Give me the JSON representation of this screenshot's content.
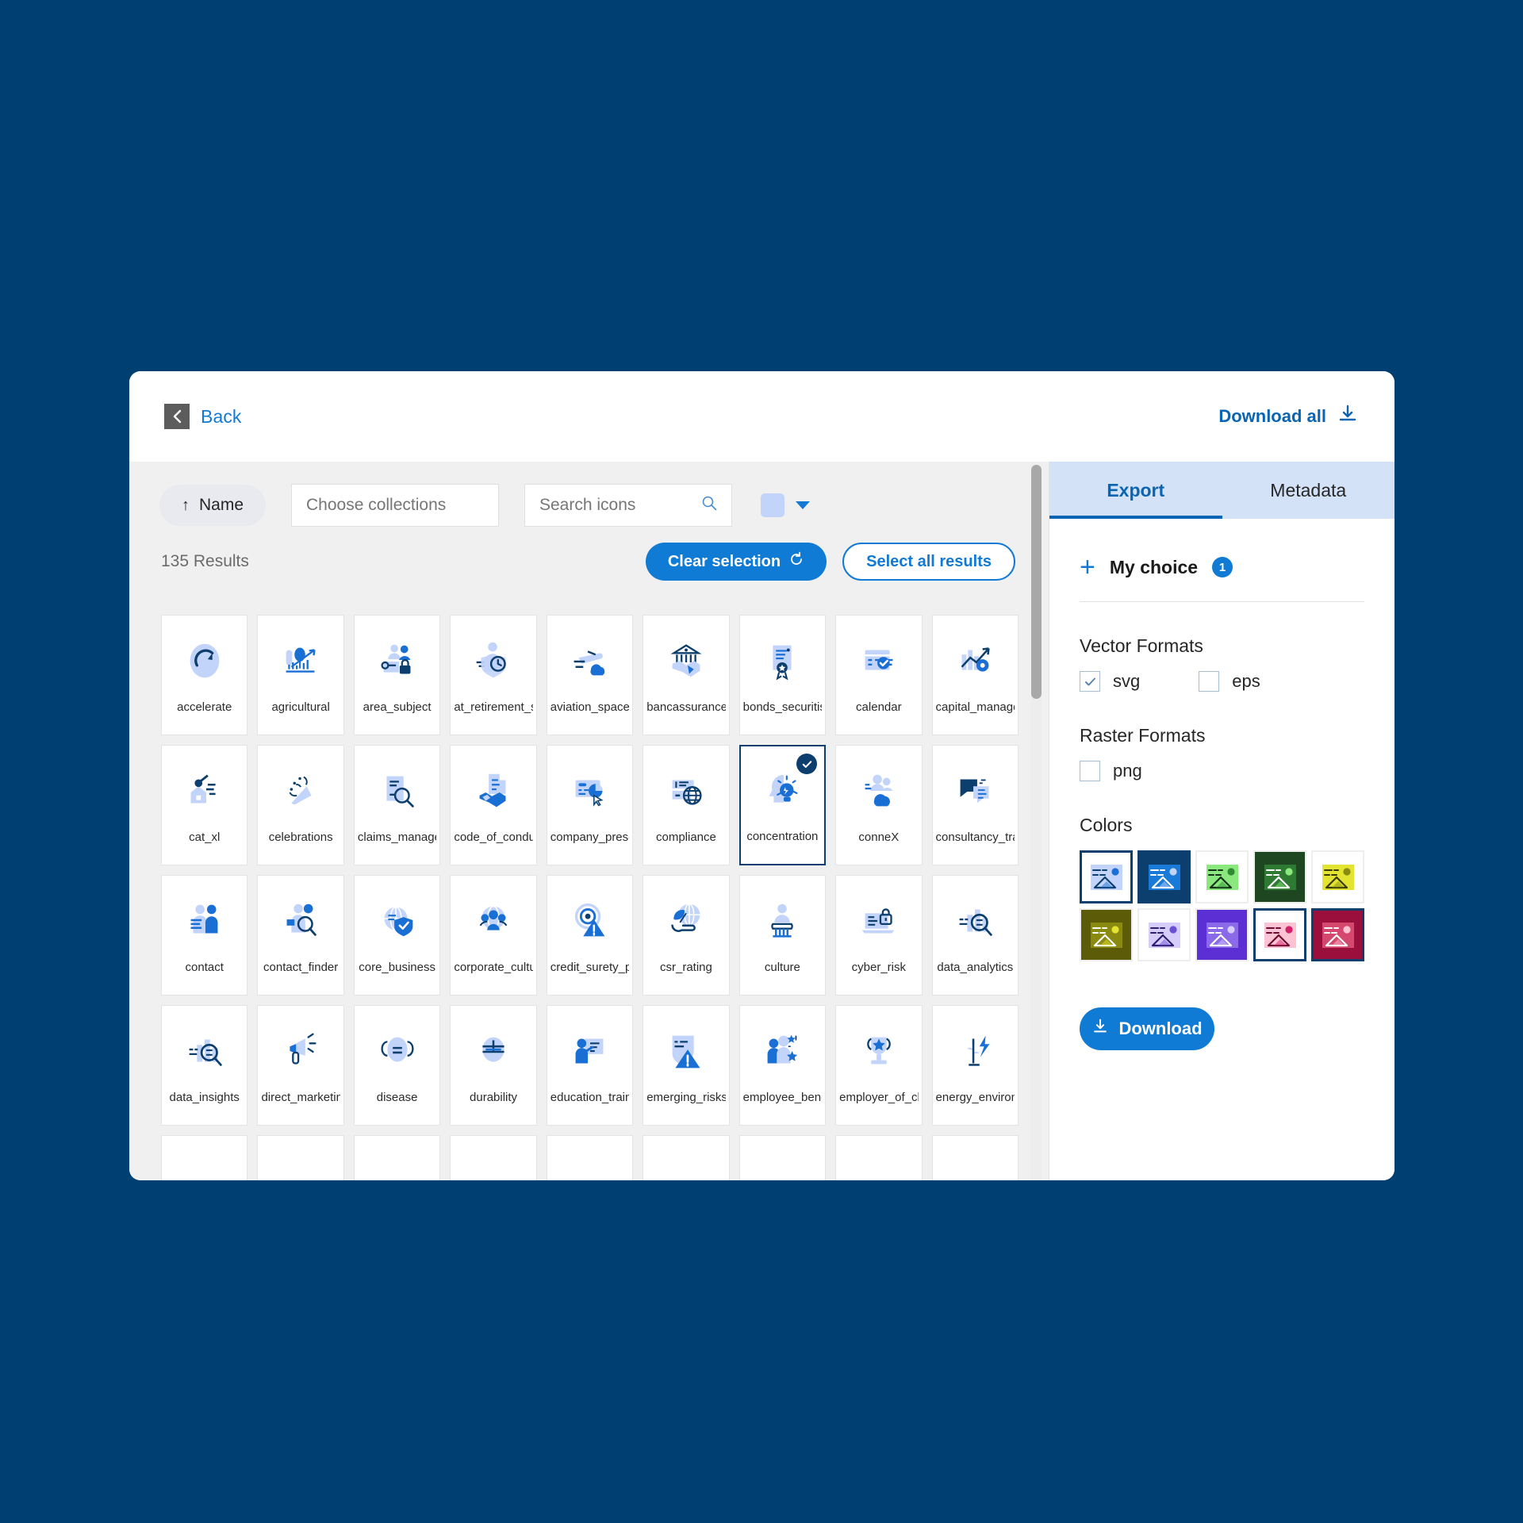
{
  "header": {
    "back_label": "Back",
    "download_all_label": "Download all"
  },
  "toolbar": {
    "sort_label": "Name",
    "sort_direction_icon": "arrow-up-icon",
    "collections_placeholder": "Choose collections",
    "collections_value": "",
    "search_placeholder": "Search icons",
    "search_value": "",
    "color_swatch_hex": "#c3d4fb"
  },
  "results": {
    "count_label": "135 Results",
    "clear_selection_label": "Clear selection",
    "select_all_label": "Select all results"
  },
  "grid": {
    "items": [
      {
        "label": "accelerate",
        "icon": "speedometer-icon",
        "selected": false
      },
      {
        "label": "agricultural",
        "icon": "agriculture-chart-icon",
        "selected": false
      },
      {
        "label": "area_subject",
        "icon": "people-lock-icon",
        "selected": false
      },
      {
        "label": "at_retirement_sol...",
        "icon": "person-shield-clock-icon",
        "selected": false
      },
      {
        "label": "aviation_space",
        "icon": "plane-cloud-icon",
        "selected": false
      },
      {
        "label": "bancassurance",
        "icon": "bank-handshake-icon",
        "selected": false
      },
      {
        "label": "bonds_securitisa...",
        "icon": "certificate-icon",
        "selected": false
      },
      {
        "label": "calendar",
        "icon": "calendar-check-icon",
        "selected": false
      },
      {
        "label": "capital_manage...",
        "icon": "bars-gear-arrow-icon",
        "selected": false
      },
      {
        "label": "cat_xl",
        "icon": "house-storm-icon",
        "selected": false
      },
      {
        "label": "celebrations",
        "icon": "party-popper-icon",
        "selected": false
      },
      {
        "label": "claims_manage...",
        "icon": "document-magnifier-icon",
        "selected": false
      },
      {
        "label": "code_of_conduct",
        "icon": "document-handshake-icon",
        "selected": false
      },
      {
        "label": "company_presen...",
        "icon": "presentation-cursor-icon",
        "selected": false
      },
      {
        "label": "compliance",
        "icon": "paragraph-globe-icon",
        "selected": false
      },
      {
        "label": "concentration",
        "icon": "head-lightbulb-icon",
        "selected": true
      },
      {
        "label": "conneX",
        "icon": "people-cloud-icon",
        "selected": false
      },
      {
        "label": "consultancy_trai...",
        "icon": "chat-bubbles-icon",
        "selected": false
      },
      {
        "label": "contact",
        "icon": "person-card-icon",
        "selected": false
      },
      {
        "label": "contact_finder",
        "icon": "person-search-icon",
        "selected": false
      },
      {
        "label": "core_business",
        "icon": "globe-shield-icon",
        "selected": false
      },
      {
        "label": "corporate_culture",
        "icon": "people-globe-icon",
        "selected": false
      },
      {
        "label": "credit_surety_pol...",
        "icon": "target-warning-icon",
        "selected": false
      },
      {
        "label": "csr_rating",
        "icon": "hand-leaf-globe-icon",
        "selected": false
      },
      {
        "label": "culture",
        "icon": "museum-bust-icon",
        "selected": false
      },
      {
        "label": "cyber_risk",
        "icon": "laptop-lock-icon",
        "selected": false
      },
      {
        "label": "data_analytics",
        "icon": "bars-magnifier-icon",
        "selected": false
      },
      {
        "label": "data_insights",
        "icon": "bars-magnifier-icon",
        "selected": false
      },
      {
        "label": "direct_marketing",
        "icon": "megaphone-icon",
        "selected": false
      },
      {
        "label": "disease",
        "icon": "face-mask-icon",
        "selected": false
      },
      {
        "label": "durability",
        "icon": "durability-gauge-icon",
        "selected": false
      },
      {
        "label": "education_training",
        "icon": "teacher-board-icon",
        "selected": false
      },
      {
        "label": "emerging_risks",
        "icon": "shield-warning-icon",
        "selected": false
      },
      {
        "label": "employee_benefits",
        "icon": "people-stars-icon",
        "selected": false
      },
      {
        "label": "employer_of_cho...",
        "icon": "trophy-star-icon",
        "selected": false
      },
      {
        "label": "energy_environm...",
        "icon": "plant-bolt-icon",
        "selected": false
      }
    ]
  },
  "panel": {
    "tabs": [
      {
        "label": "Export",
        "active": true
      },
      {
        "label": "Metadata",
        "active": false
      }
    ],
    "my_choice_label": "My choice",
    "my_choice_count": "1",
    "vector_formats_title": "Vector Formats",
    "vector_formats": [
      {
        "label": "svg",
        "checked": true
      },
      {
        "label": "eps",
        "checked": false
      }
    ],
    "raster_formats_title": "Raster Formats",
    "raster_formats": [
      {
        "label": "png",
        "checked": false
      }
    ],
    "colors_title": "Colors",
    "colors": [
      {
        "bg": "#ffffff",
        "fill": "#c3d4fb",
        "accent": "#1a6fd4",
        "dark": "#0d3f6e",
        "selected": true
      },
      {
        "bg": "#0d3f6e",
        "fill": "#1a7ad8",
        "accent": "#c3d4fb",
        "dark": "#ffffff",
        "selected": true
      },
      {
        "bg": "#ffffff",
        "fill": "#8ae87f",
        "accent": "#2e8b32",
        "dark": "#16331a",
        "selected": false
      },
      {
        "bg": "#1e4620",
        "fill": "#2f7a33",
        "accent": "#8ae87f",
        "dark": "#ffffff",
        "selected": false
      },
      {
        "bg": "#ffffff",
        "fill": "#e3e331",
        "accent": "#8a8a10",
        "dark": "#3a3a08",
        "selected": false
      },
      {
        "bg": "#5c5c08",
        "fill": "#8a8a10",
        "accent": "#e3e331",
        "dark": "#ffffff",
        "selected": false
      },
      {
        "bg": "#ffffff",
        "fill": "#d6cdfb",
        "accent": "#6a4fd4",
        "dark": "#2f1f6e",
        "selected": false
      },
      {
        "bg": "#5b2fd4",
        "fill": "#8a6ae8",
        "accent": "#d6cdfb",
        "dark": "#ffffff",
        "selected": false
      },
      {
        "bg": "#ffffff",
        "fill": "#fbc3d4",
        "accent": "#d4206a",
        "dark": "#6e0d2f",
        "selected": true
      },
      {
        "bg": "#9b0f3c",
        "fill": "#d4486e",
        "accent": "#fbc3d4",
        "dark": "#ffffff",
        "selected": true
      }
    ],
    "download_label": "Download"
  }
}
